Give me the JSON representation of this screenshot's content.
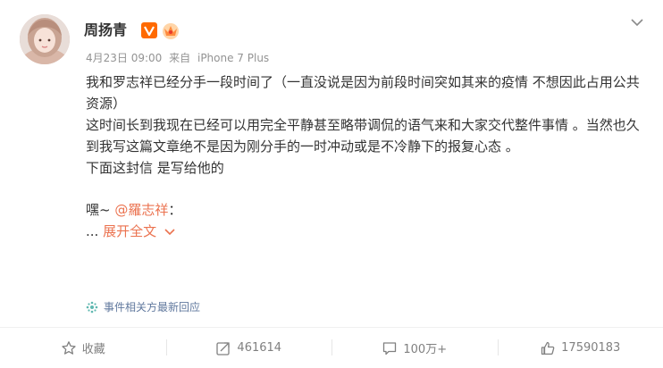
{
  "post": {
    "author": "周扬青",
    "date": "4月23日 09:00",
    "source_prefix": "来自",
    "source_device": "iPhone 7 Plus",
    "paragraphs": [
      "我和罗志祥已经分手一段时间了（一直没说是因为前段时间突如其来的疫情 不想因此占用公共资源）",
      "这时间长到我现在已经可以用完全平静甚至略带调侃的语气来和大家交代整件事情 。当然也久到我写这篇文章绝不是因为刚分手的一时冲动或是不冷静下的报复心态 。",
      "下面这封信 是写给他的"
    ],
    "greeting_prefix": "嘿~ ",
    "mention": "@羅志祥",
    "greeting_suffix": "：",
    "ellipsis": "... ",
    "expand_label": "展开全文",
    "event_label": "事件相关方最新回应"
  },
  "actions": {
    "favorite_label": "收藏",
    "repost_count": "461614",
    "comment_count": "100万+",
    "like_count": "17590183"
  },
  "colors": {
    "accent": "#eb7350",
    "verified": "#ff6a00",
    "event_link": "#61799e",
    "meta": "#939393"
  },
  "icons": [
    "avatar",
    "verified-v-icon",
    "vip-crown-icon",
    "chevron-down-icon",
    "star-icon",
    "repost-icon",
    "comment-icon",
    "like-icon",
    "event-icon"
  ]
}
